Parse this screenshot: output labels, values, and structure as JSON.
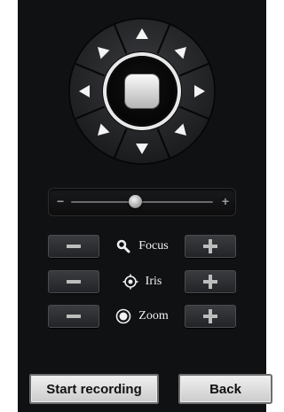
{
  "ptz": {
    "directions": [
      "up",
      "up-right",
      "right",
      "down-right",
      "down",
      "down-left",
      "left",
      "up-left"
    ],
    "center_icon": "stop-square-icon"
  },
  "speed": {
    "value": 0.45
  },
  "controls": {
    "focus": {
      "label": "Focus",
      "icon": "magnifier-icon"
    },
    "iris": {
      "label": "Iris",
      "icon": "iris-target-icon"
    },
    "zoom": {
      "label": "Zoom",
      "icon": "lens-circle-icon"
    }
  },
  "actions": {
    "start_label": "Start recording",
    "back_label": "Back"
  },
  "colors": {
    "panel_bg": "#101113",
    "button_bg": "#2e2f32",
    "text": "#f2f2f2"
  }
}
